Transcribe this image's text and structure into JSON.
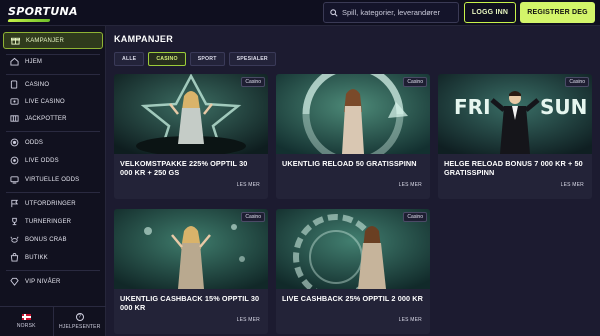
{
  "header": {
    "logo_text": "SPORTUNA",
    "search_placeholder": "Spill, kategorier, leverandører",
    "login_label": "LOGG INN",
    "register_label": "REGISTRER DEG"
  },
  "sidebar": {
    "items": [
      {
        "label": "KAMPANJER",
        "icon": "gift-icon",
        "active": true
      },
      {
        "label": "HJEM",
        "icon": "home-icon"
      },
      {
        "label": "CASINO",
        "icon": "cards-icon"
      },
      {
        "label": "LIVE CASINO",
        "icon": "live-casino-icon"
      },
      {
        "label": "JACKPOTTER",
        "icon": "jackpot-icon"
      },
      {
        "label": "ODDS",
        "icon": "odds-icon"
      },
      {
        "label": "LIVE ODDS",
        "icon": "live-odds-icon"
      },
      {
        "label": "VIRTUELLE ODDS",
        "icon": "virtual-odds-icon"
      },
      {
        "label": "UTFORDRINGER",
        "icon": "challenges-icon"
      },
      {
        "label": "TURNERINGER",
        "icon": "tournaments-icon"
      },
      {
        "label": "BONUS CRAB",
        "icon": "bonus-crab-icon"
      },
      {
        "label": "BUTIKK",
        "icon": "shop-icon"
      },
      {
        "label": "VIP NIVÅER",
        "icon": "vip-diamond-icon"
      }
    ],
    "language_label": "NORSK",
    "help_label": "HJELPESENTER"
  },
  "main": {
    "title": "KAMPANJER",
    "filters": [
      {
        "label": "ALLE",
        "active": false
      },
      {
        "label": "CASINO",
        "active": true
      },
      {
        "label": "SPORT",
        "active": false
      },
      {
        "label": "SPESIALER",
        "active": false
      }
    ],
    "cards": [
      {
        "tag": "Casino",
        "title": "VELKOMSTPAKKE 225% OPPTIL 30 000 KR + 250 GS",
        "more": "LES MER"
      },
      {
        "tag": "Casino",
        "title": "UKENTLIG RELOAD 50 GRATISSPINN",
        "more": "LES MER"
      },
      {
        "tag": "Casino",
        "title": "HELGE RELOAD BONUS 7 000 KR + 50 GRATISSPINN",
        "more": "LES MER",
        "image_text_left": "FRI",
        "image_text_right": "SUN"
      },
      {
        "tag": "Casino",
        "title": "UKENTLIG CASHBACK 15% OPPTIL 30 000 KR",
        "more": "LES MER"
      },
      {
        "tag": "Casino",
        "title": "LIVE CASHBACK 25% OPPTIL 2 000 KR",
        "more": "LES MER"
      }
    ]
  },
  "colors": {
    "accent": "#d3f56a",
    "background": "#1c1b30",
    "sidebar": "#11111f",
    "card": "#232338"
  }
}
